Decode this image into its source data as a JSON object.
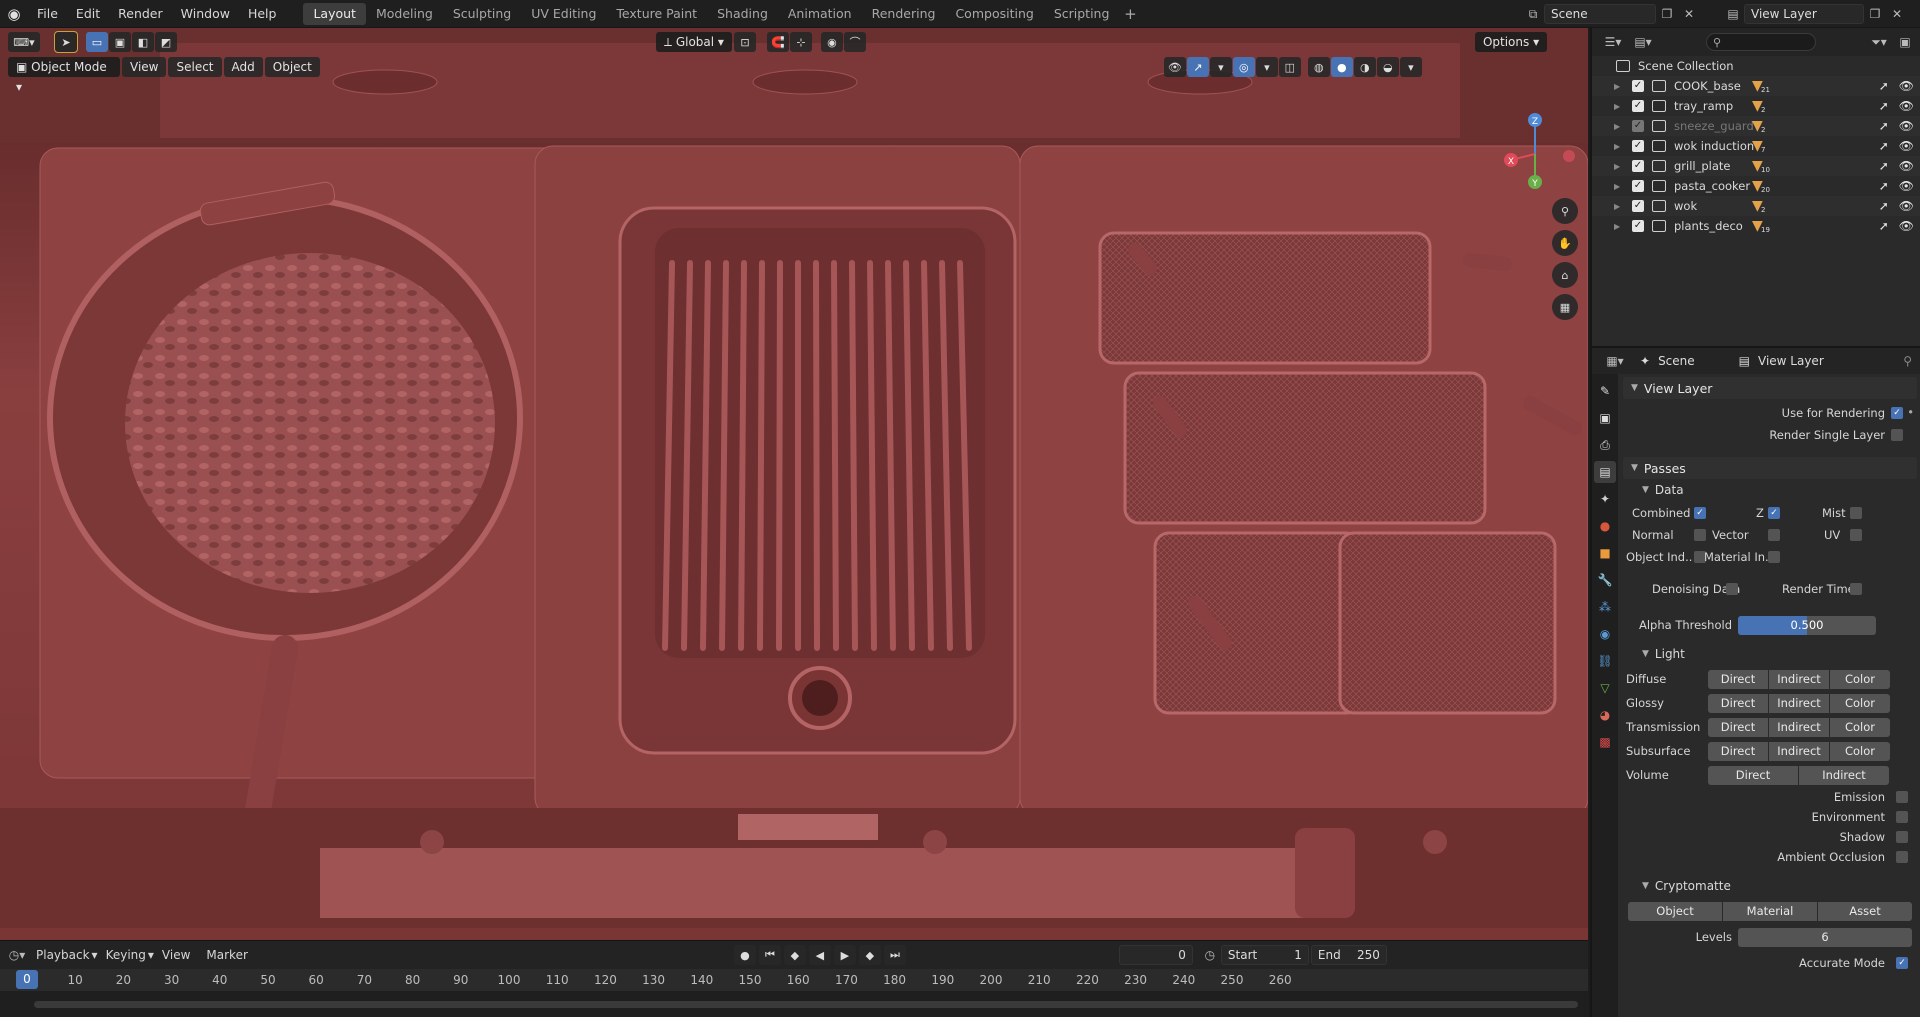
{
  "menubar": {
    "items": [
      "File",
      "Edit",
      "Render",
      "Window",
      "Help"
    ],
    "workspaces": [
      "Layout",
      "Modeling",
      "Sculpting",
      "UV Editing",
      "Texture Paint",
      "Shading",
      "Animation",
      "Rendering",
      "Compositing",
      "Scripting"
    ],
    "active_workspace": "Layout",
    "scene_name": "Scene",
    "view_layer_name": "View Layer"
  },
  "viewport": {
    "mode": "Object Mode",
    "menus": [
      "View",
      "Select",
      "Add",
      "Object"
    ],
    "transform_orientation": "Global",
    "options_label": "Options",
    "gizmo_labels": {
      "x": "X",
      "y": "Y",
      "z": "Z"
    }
  },
  "timeline": {
    "menus": [
      "Playback",
      "Keying",
      "View",
      "Marker"
    ],
    "current_frame": "0",
    "start_label": "Start",
    "start_value": "1",
    "end_label": "End",
    "end_value": "250",
    "ticks": [
      "0",
      "10",
      "20",
      "30",
      "40",
      "50",
      "60",
      "70",
      "80",
      "90",
      "100",
      "110",
      "120",
      "130",
      "140",
      "150",
      "160",
      "170",
      "180",
      "190",
      "200",
      "210",
      "220",
      "230",
      "240",
      "250",
      "260"
    ]
  },
  "outliner": {
    "root": "Scene Collection",
    "collections": [
      {
        "name": "COOK_base",
        "count": "21",
        "dim": false
      },
      {
        "name": "tray_ramp",
        "count": "2",
        "dim": false
      },
      {
        "name": "sneeze_guard",
        "count": "2",
        "dim": true
      },
      {
        "name": "wok induction",
        "count": "7",
        "dim": false
      },
      {
        "name": "grill_plate",
        "count": "10",
        "dim": false
      },
      {
        "name": "pasta_cooker",
        "count": "20",
        "dim": false
      },
      {
        "name": "wok",
        "count": "2",
        "dim": false
      },
      {
        "name": "plants_deco",
        "count": "19",
        "dim": false
      }
    ]
  },
  "properties": {
    "header_scene": "Scene",
    "header_view_layer": "View Layer",
    "view_layer_panel": "View Layer",
    "use_for_rendering": "Use for Rendering",
    "render_single_layer": "Render Single Layer",
    "passes_panel": "Passes",
    "data_sub": "Data",
    "combined": "Combined",
    "z": "Z",
    "mist": "Mist",
    "normal": "Normal",
    "vector": "Vector",
    "uv": "UV",
    "object_index": "Object Ind..",
    "material_index": "Material In..",
    "denoising_data": "Denoising Data",
    "render_time": "Render Time",
    "alpha_threshold_label": "Alpha Threshold",
    "alpha_threshold_value": "0.500",
    "alpha_threshold_fraction": 0.5,
    "light_sub": "Light",
    "light_rows": [
      {
        "label": "Diffuse",
        "buttons": [
          "Direct",
          "Indirect",
          "Color"
        ]
      },
      {
        "label": "Glossy",
        "buttons": [
          "Direct",
          "Indirect",
          "Color"
        ]
      },
      {
        "label": "Transmission",
        "buttons": [
          "Direct",
          "Indirect",
          "Color"
        ]
      },
      {
        "label": "Subsurface",
        "buttons": [
          "Direct",
          "Indirect",
          "Color"
        ]
      },
      {
        "label": "Volume",
        "buttons": [
          "Direct",
          "Indirect"
        ]
      }
    ],
    "emission": "Emission",
    "environment": "Environment",
    "shadow": "Shadow",
    "ambient_occlusion": "Ambient Occlusion",
    "cryptomatte_sub": "Cryptomatte",
    "crypto_buttons": [
      "Object",
      "Material",
      "Asset"
    ],
    "levels_label": "Levels",
    "levels_value": "6",
    "accurate_mode": "Accurate Mode"
  },
  "colors": {
    "accent": "#4772b3",
    "viewport_clay": "#8a3f3f",
    "object_triangle": "#e3a24a"
  }
}
